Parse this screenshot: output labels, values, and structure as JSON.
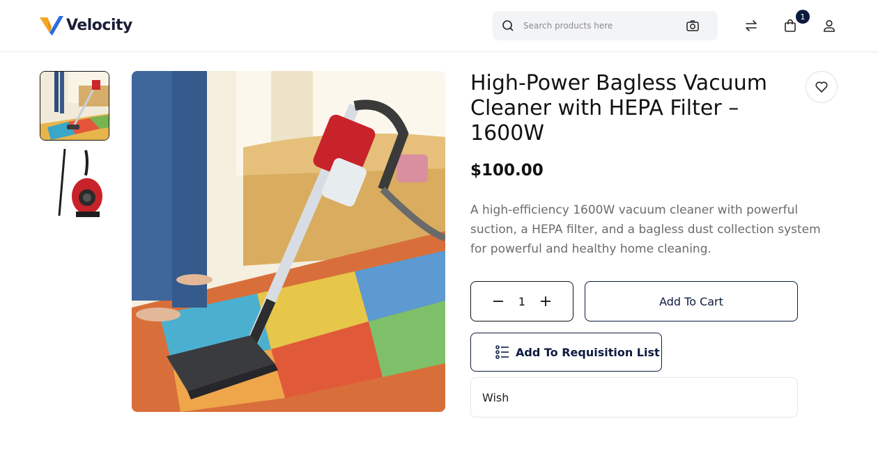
{
  "header": {
    "brand": "Velocity",
    "search_placeholder": "Search products here",
    "cart_count": "1"
  },
  "product": {
    "title": "High-Power Bagless Vacuum Cleaner with HEPA Filter – 1600W",
    "price": "$100.00",
    "description": "A high-efficiency 1600W vacuum cleaner with powerful suction, a HEPA filter, and a bagless dust collection system for powerful and healthy home cleaning.",
    "quantity": "1",
    "add_to_cart_label": "Add To Cart",
    "requisition_label": "Add To Requisition List",
    "wish_label": "Wish"
  },
  "icons": {
    "search": "search-icon",
    "camera": "camera-icon",
    "compare": "compare-arrows-icon",
    "cart": "shopping-bag-icon",
    "account": "user-icon",
    "wishlist": "heart-icon",
    "minus": "minus-icon",
    "plus": "plus-icon",
    "list": "list-icon"
  },
  "colors": {
    "brand_dark": "#0c1a3e",
    "logo_yellow": "#f5a623",
    "logo_blue": "#2d6cdf"
  }
}
